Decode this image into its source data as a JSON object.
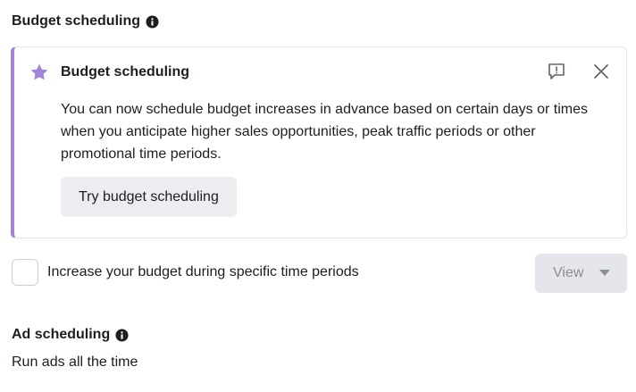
{
  "budget_section": {
    "title": "Budget scheduling",
    "info_icon": "info-circle-icon"
  },
  "promo_card": {
    "icon": "star-icon",
    "title": "Budget scheduling",
    "body": "You can now schedule budget increases in advance based on certain days or times when you anticipate higher sales opportunities, peak traffic periods or other promotional time periods.",
    "button_label": "Try budget scheduling",
    "feedback_icon": "feedback-icon",
    "close_icon": "close-icon",
    "accent_color": "#a384d9"
  },
  "schedule_option": {
    "checked": false,
    "label": "Increase your budget during specific time periods",
    "view_label": "View",
    "view_disabled": true
  },
  "ad_section": {
    "title": "Ad scheduling",
    "info_icon": "info-circle-icon",
    "value": "Run ads all the time"
  }
}
